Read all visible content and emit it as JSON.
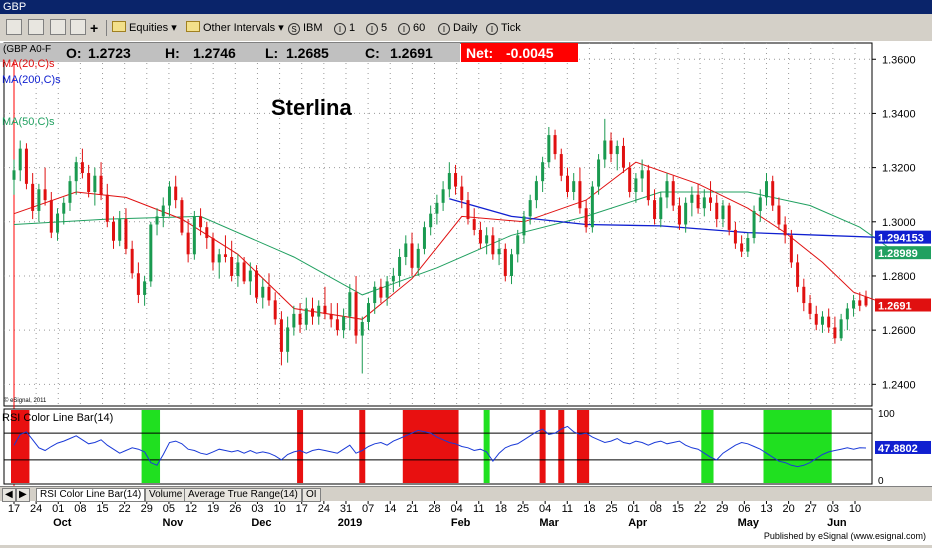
{
  "window": {
    "title": "GBP"
  },
  "toolbar": {
    "icons": [
      "link-icon",
      "new-chart-icon",
      "page-icon",
      "properties-icon",
      "add-icon"
    ],
    "equities": "Equities",
    "other_intervals": "Other Intervals",
    "intervals": [
      {
        "icon": "S",
        "label": "IBM"
      },
      {
        "icon": "I",
        "label": "1"
      },
      {
        "icon": "I",
        "label": "5"
      },
      {
        "icon": "I",
        "label": "60"
      },
      {
        "icon": "I",
        "label": "Daily"
      },
      {
        "icon": "I",
        "label": "Tick"
      }
    ]
  },
  "quote": {
    "symbol": "(GBP A0-F",
    "o_label": "O:",
    "o": "1.2723",
    "h_label": "H:",
    "h": "1.2746",
    "l_label": "L:",
    "l": "1.2685",
    "c_label": "C:",
    "c": "1.2691",
    "net_label": "Net:",
    "net": "-0.0045"
  },
  "legend": {
    "ma20": "MA(20,C)s",
    "ma200": "MA(200,C)s",
    "ma50": "MA(50,C)s"
  },
  "colors": {
    "up": "#1a9a50",
    "down": "#e01010",
    "ma20": "#e01010",
    "ma200": "#1020d0",
    "ma50": "#20a060",
    "rsi_line": "#1a3ad8",
    "rsi_hot": "#e81010",
    "rsi_cold": "#20e020"
  },
  "copyright": "© eSignal, 2011",
  "rsi_title": "RSI Color Line Bar(14)",
  "tabs": [
    "RSI Color Line Bar(14)",
    "Volume",
    "Average True Range(14)",
    "OI"
  ],
  "footer": "Published by eSignal (www.esignal.com)",
  "chart_data": {
    "type": "candlestick",
    "title": "Sterlina",
    "y_ticks": [
      1.24,
      1.26,
      1.28,
      1.3,
      1.32,
      1.34,
      1.36
    ],
    "ylim": [
      1.232,
      1.366
    ],
    "price_labels": [
      {
        "value": 1.29415,
        "text": "1.294153",
        "series": "MA(200,C)s"
      },
      {
        "value": 1.28989,
        "text": "1.28989",
        "series": "MA(50,C)s"
      },
      {
        "value": 1.2691,
        "text": "1.2691",
        "series": "Close"
      }
    ],
    "x_day_labels": [
      "17",
      "24",
      "01",
      "08",
      "15",
      "22",
      "29",
      "05",
      "12",
      "19",
      "26",
      "03",
      "10",
      "17",
      "24",
      "31",
      "07",
      "14",
      "21",
      "28",
      "04",
      "11",
      "18",
      "25",
      "04",
      "11",
      "18",
      "25",
      "01",
      "08",
      "15",
      "22",
      "29",
      "06",
      "13",
      "20",
      "27",
      "03",
      "10"
    ],
    "x_month_labels": [
      {
        "label": "Oct",
        "at": 2
      },
      {
        "label": "Nov",
        "at": 7
      },
      {
        "label": "Dec",
        "at": 11
      },
      {
        "label": "2019",
        "at": 15
      },
      {
        "label": "Feb",
        "at": 20
      },
      {
        "label": "Mar",
        "at": 24
      },
      {
        "label": "Apr",
        "at": 28
      },
      {
        "label": "May",
        "at": 33
      },
      {
        "label": "Jun",
        "at": 37
      }
    ],
    "candles": [
      [
        1.3155,
        1.323,
        1.31,
        1.319
      ],
      [
        1.319,
        1.33,
        1.315,
        1.327
      ],
      [
        1.327,
        1.329,
        1.312,
        1.314
      ],
      [
        1.314,
        1.318,
        1.301,
        1.304
      ],
      [
        1.304,
        1.314,
        1.3,
        1.312
      ],
      [
        1.312,
        1.32,
        1.306,
        1.308
      ],
      [
        1.308,
        1.311,
        1.294,
        1.296
      ],
      [
        1.296,
        1.305,
        1.293,
        1.303
      ],
      [
        1.303,
        1.309,
        1.299,
        1.307
      ],
      [
        1.307,
        1.317,
        1.304,
        1.315
      ],
      [
        1.315,
        1.324,
        1.31,
        1.322
      ],
      [
        1.322,
        1.327,
        1.316,
        1.318
      ],
      [
        1.318,
        1.321,
        1.309,
        1.311
      ],
      [
        1.311,
        1.32,
        1.306,
        1.317
      ],
      [
        1.317,
        1.322,
        1.308,
        1.31
      ],
      [
        1.31,
        1.314,
        1.298,
        1.3
      ],
      [
        1.3,
        1.302,
        1.29,
        1.293
      ],
      [
        1.293,
        1.304,
        1.291,
        1.301
      ],
      [
        1.301,
        1.305,
        1.288,
        1.29
      ],
      [
        1.29,
        1.293,
        1.279,
        1.281
      ],
      [
        1.281,
        1.285,
        1.27,
        1.273
      ],
      [
        1.273,
        1.28,
        1.269,
        1.278
      ],
      [
        1.278,
        1.3,
        1.276,
        1.299
      ],
      [
        1.299,
        1.305,
        1.295,
        1.302
      ],
      [
        1.302,
        1.309,
        1.298,
        1.306
      ],
      [
        1.306,
        1.315,
        1.302,
        1.313
      ],
      [
        1.313,
        1.317,
        1.305,
        1.308
      ],
      [
        1.308,
        1.309,
        1.295,
        1.296
      ],
      [
        1.296,
        1.301,
        1.285,
        1.288
      ],
      [
        1.288,
        1.304,
        1.286,
        1.302
      ],
      [
        1.302,
        1.305,
        1.295,
        1.298
      ],
      [
        1.298,
        1.3,
        1.29,
        1.294
      ],
      [
        1.294,
        1.296,
        1.282,
        1.285
      ],
      [
        1.285,
        1.29,
        1.279,
        1.288
      ],
      [
        1.288,
        1.295,
        1.285,
        1.287
      ],
      [
        1.287,
        1.293,
        1.278,
        1.28
      ],
      [
        1.28,
        1.288,
        1.276,
        1.285
      ],
      [
        1.285,
        1.287,
        1.277,
        1.278
      ],
      [
        1.278,
        1.285,
        1.273,
        1.282
      ],
      [
        1.282,
        1.284,
        1.27,
        1.272
      ],
      [
        1.272,
        1.279,
        1.268,
        1.276
      ],
      [
        1.276,
        1.281,
        1.269,
        1.271
      ],
      [
        1.271,
        1.274,
        1.262,
        1.264
      ],
      [
        1.264,
        1.267,
        1.247,
        1.252
      ],
      [
        1.252,
        1.265,
        1.248,
        1.261
      ],
      [
        1.261,
        1.269,
        1.258,
        1.266
      ],
      [
        1.266,
        1.27,
        1.259,
        1.262
      ],
      [
        1.262,
        1.272,
        1.26,
        1.268
      ],
      [
        1.268,
        1.272,
        1.262,
        1.265
      ],
      [
        1.265,
        1.271,
        1.262,
        1.269
      ],
      [
        1.269,
        1.276,
        1.264,
        1.266
      ],
      [
        1.266,
        1.27,
        1.261,
        1.264
      ],
      [
        1.264,
        1.27,
        1.258,
        1.26
      ],
      [
        1.26,
        1.268,
        1.257,
        1.265
      ],
      [
        1.265,
        1.277,
        1.26,
        1.274
      ],
      [
        1.274,
        1.28,
        1.255,
        1.258
      ],
      [
        1.258,
        1.265,
        1.244,
        1.263
      ],
      [
        1.263,
        1.272,
        1.26,
        1.27
      ],
      [
        1.27,
        1.278,
        1.266,
        1.276
      ],
      [
        1.276,
        1.279,
        1.27,
        1.272
      ],
      [
        1.272,
        1.28,
        1.269,
        1.278
      ],
      [
        1.278,
        1.283,
        1.274,
        1.28
      ],
      [
        1.28,
        1.29,
        1.276,
        1.287
      ],
      [
        1.287,
        1.295,
        1.284,
        1.292
      ],
      [
        1.292,
        1.296,
        1.28,
        1.283
      ],
      [
        1.283,
        1.292,
        1.28,
        1.29
      ],
      [
        1.29,
        1.3,
        1.288,
        1.298
      ],
      [
        1.298,
        1.306,
        1.295,
        1.303
      ],
      [
        1.303,
        1.31,
        1.299,
        1.307
      ],
      [
        1.307,
        1.315,
        1.304,
        1.312
      ],
      [
        1.312,
        1.322,
        1.309,
        1.318
      ],
      [
        1.318,
        1.321,
        1.31,
        1.313
      ],
      [
        1.313,
        1.317,
        1.305,
        1.308
      ],
      [
        1.308,
        1.311,
        1.299,
        1.301
      ],
      [
        1.301,
        1.305,
        1.295,
        1.297
      ],
      [
        1.297,
        1.3,
        1.29,
        1.292
      ],
      [
        1.292,
        1.298,
        1.288,
        1.295
      ],
      [
        1.295,
        1.298,
        1.286,
        1.288
      ],
      [
        1.288,
        1.294,
        1.284,
        1.29
      ],
      [
        1.29,
        1.292,
        1.278,
        1.28
      ],
      [
        1.28,
        1.29,
        1.277,
        1.288
      ],
      [
        1.288,
        1.297,
        1.285,
        1.295
      ],
      [
        1.295,
        1.304,
        1.292,
        1.302
      ],
      [
        1.302,
        1.31,
        1.299,
        1.308
      ],
      [
        1.308,
        1.317,
        1.305,
        1.315
      ],
      [
        1.315,
        1.324,
        1.311,
        1.322
      ],
      [
        1.322,
        1.335,
        1.32,
        1.332
      ],
      [
        1.332,
        1.334,
        1.323,
        1.325
      ],
      [
        1.325,
        1.327,
        1.315,
        1.317
      ],
      [
        1.317,
        1.32,
        1.309,
        1.311
      ],
      [
        1.311,
        1.318,
        1.308,
        1.315
      ],
      [
        1.315,
        1.32,
        1.303,
        1.305
      ],
      [
        1.305,
        1.308,
        1.296,
        1.298
      ],
      [
        1.298,
        1.315,
        1.296,
        1.313
      ],
      [
        1.313,
        1.325,
        1.31,
        1.323
      ],
      [
        1.323,
        1.338,
        1.32,
        1.33
      ],
      [
        1.33,
        1.333,
        1.322,
        1.325
      ],
      [
        1.325,
        1.33,
        1.319,
        1.328
      ],
      [
        1.328,
        1.331,
        1.318,
        1.32
      ],
      [
        1.32,
        1.322,
        1.309,
        1.311
      ],
      [
        1.311,
        1.318,
        1.307,
        1.316
      ],
      [
        1.316,
        1.323,
        1.311,
        1.319
      ],
      [
        1.319,
        1.321,
        1.306,
        1.308
      ],
      [
        1.308,
        1.312,
        1.299,
        1.301
      ],
      [
        1.301,
        1.311,
        1.298,
        1.309
      ],
      [
        1.309,
        1.318,
        1.305,
        1.315
      ],
      [
        1.315,
        1.317,
        1.304,
        1.306
      ],
      [
        1.306,
        1.309,
        1.297,
        1.299
      ],
      [
        1.299,
        1.309,
        1.296,
        1.307
      ],
      [
        1.307,
        1.313,
        1.302,
        1.31
      ],
      [
        1.31,
        1.314,
        1.303,
        1.305
      ],
      [
        1.305,
        1.312,
        1.302,
        1.309
      ],
      [
        1.309,
        1.315,
        1.304,
        1.307
      ],
      [
        1.307,
        1.31,
        1.298,
        1.301
      ],
      [
        1.301,
        1.308,
        1.298,
        1.306
      ],
      [
        1.306,
        1.307,
        1.295,
        1.297
      ],
      [
        1.297,
        1.3,
        1.29,
        1.292
      ],
      [
        1.292,
        1.295,
        1.287,
        1.289
      ],
      [
        1.289,
        1.296,
        1.287,
        1.294
      ],
      [
        1.294,
        1.306,
        1.292,
        1.304
      ],
      [
        1.304,
        1.312,
        1.3,
        1.309
      ],
      [
        1.309,
        1.318,
        1.306,
        1.315
      ],
      [
        1.315,
        1.317,
        1.304,
        1.306
      ],
      [
        1.306,
        1.309,
        1.297,
        1.299
      ],
      [
        1.299,
        1.302,
        1.292,
        1.295
      ],
      [
        1.295,
        1.297,
        1.283,
        1.285
      ],
      [
        1.285,
        1.288,
        1.274,
        1.276
      ],
      [
        1.276,
        1.279,
        1.267,
        1.27
      ],
      [
        1.27,
        1.273,
        1.264,
        1.266
      ],
      [
        1.266,
        1.269,
        1.26,
        1.262
      ],
      [
        1.262,
        1.267,
        1.259,
        1.265
      ],
      [
        1.265,
        1.268,
        1.259,
        1.261
      ],
      [
        1.261,
        1.265,
        1.255,
        1.257
      ],
      [
        1.257,
        1.266,
        1.256,
        1.264
      ],
      [
        1.264,
        1.27,
        1.26,
        1.268
      ],
      [
        1.268,
        1.273,
        1.265,
        1.271
      ],
      [
        1.271,
        1.274,
        1.267,
        1.269
      ],
      [
        1.2723,
        1.2746,
        1.2685,
        1.2691
      ]
    ],
    "ma20": [
      [
        0,
        1.303
      ],
      [
        10,
        1.311
      ],
      [
        18,
        1.309
      ],
      [
        27,
        1.301
      ],
      [
        36,
        1.288
      ],
      [
        45,
        1.268
      ],
      [
        56,
        1.264
      ],
      [
        64,
        1.279
      ],
      [
        72,
        1.302
      ],
      [
        82,
        1.3
      ],
      [
        92,
        1.308
      ],
      [
        100,
        1.322
      ],
      [
        110,
        1.314
      ],
      [
        118,
        1.305
      ],
      [
        124,
        1.296
      ],
      [
        130,
        1.285
      ],
      [
        135,
        1.274
      ],
      [
        141,
        1.269
      ]
    ],
    "ma50": [
      [
        0,
        1.299
      ],
      [
        15,
        1.301
      ],
      [
        30,
        1.302
      ],
      [
        45,
        1.287
      ],
      [
        56,
        1.273
      ],
      [
        68,
        1.283
      ],
      [
        80,
        1.295
      ],
      [
        92,
        1.302
      ],
      [
        104,
        1.311
      ],
      [
        118,
        1.311
      ],
      [
        128,
        1.306
      ],
      [
        136,
        1.298
      ],
      [
        141,
        1.2899
      ]
    ],
    "ma200": [
      [
        70,
        1.3085
      ],
      [
        80,
        1.302
      ],
      [
        92,
        1.299
      ],
      [
        104,
        1.2985
      ],
      [
        118,
        1.296
      ],
      [
        130,
        1.295
      ],
      [
        141,
        1.2941
      ]
    ],
    "rsi": {
      "ylim": [
        0,
        100
      ],
      "ticks": [
        0,
        50,
        100
      ],
      "overbought": 70,
      "oversold": 30,
      "last_label": "47.8802",
      "values": [
        52,
        68,
        72,
        60,
        48,
        44,
        50,
        55,
        58,
        62,
        66,
        60,
        54,
        56,
        60,
        52,
        46,
        40,
        44,
        48,
        46,
        42,
        26,
        22,
        38,
        56,
        58,
        54,
        46,
        44,
        40,
        38,
        42,
        46,
        44,
        42,
        44,
        40,
        44,
        40,
        42,
        40,
        36,
        30,
        38,
        42,
        44,
        40,
        44,
        46,
        44,
        42,
        40,
        46,
        52,
        40,
        44,
        50,
        54,
        56,
        52,
        58,
        62,
        66,
        70,
        74,
        72,
        70,
        64,
        60,
        56,
        54,
        50,
        48,
        44,
        46,
        42,
        28,
        40,
        48,
        52,
        54,
        60,
        66,
        72,
        76,
        68,
        70,
        76,
        80,
        72,
        68,
        70,
        64,
        60,
        56,
        58,
        62,
        56,
        54,
        58,
        56,
        52,
        56,
        58,
        54,
        56,
        58,
        52,
        48,
        46,
        40,
        34,
        30,
        40,
        46,
        52,
        56,
        54,
        50,
        46,
        40,
        34,
        28,
        26,
        22,
        20,
        22,
        26,
        32,
        38,
        42,
        44,
        46,
        48,
        46,
        48,
        47.8
      ],
      "hot": [
        [
          0,
          2
        ],
        [
          46,
          46
        ],
        [
          56,
          56
        ],
        [
          63,
          71
        ],
        [
          85,
          85
        ],
        [
          88,
          88
        ],
        [
          91,
          92
        ]
      ],
      "cold": [
        [
          21,
          23
        ],
        [
          76,
          76
        ],
        [
          111,
          112
        ],
        [
          121,
          131
        ]
      ]
    }
  }
}
